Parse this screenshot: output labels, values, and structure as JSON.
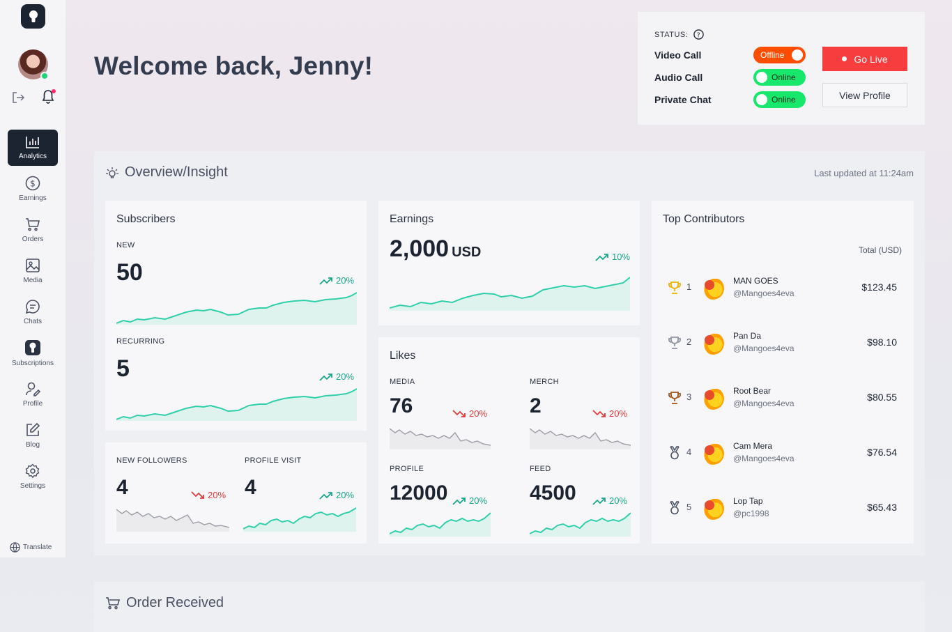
{
  "sidebar": {
    "items": [
      {
        "label": "Analytics",
        "icon": "bar-chart-icon"
      },
      {
        "label": "Earnings",
        "icon": "dollar-icon"
      },
      {
        "label": "Orders",
        "icon": "cart-icon"
      },
      {
        "label": "Media",
        "icon": "image-icon"
      },
      {
        "label": "Chats",
        "icon": "chat-icon"
      },
      {
        "label": "Subscriptions",
        "icon": "keyhole-icon"
      },
      {
        "label": "Profile",
        "icon": "user-icon"
      },
      {
        "label": "Blog",
        "icon": "edit-icon"
      },
      {
        "label": "Settings",
        "icon": "gear-icon"
      }
    ],
    "translate": "Translate"
  },
  "header": {
    "welcome": "Welcome back, Jenny!"
  },
  "status": {
    "label": "STATUS:",
    "rows": [
      {
        "label": "Video Call",
        "state": "Offline"
      },
      {
        "label": "Audio Call",
        "state": "Online"
      },
      {
        "label": "Private Chat",
        "state": "Online"
      }
    ],
    "go_live": "Go Live",
    "view_profile": "View Profile"
  },
  "overview": {
    "title": "Overview/Insight",
    "updated": "Last updated at 11:24am",
    "subscribers": {
      "title": "Subscribers",
      "new_label": "NEW",
      "new_value": "50",
      "new_trend": "20%",
      "recurring_label": "RECURRING",
      "recurring_value": "5",
      "recurring_trend": "20%"
    },
    "followers": {
      "label": "NEW FOLLOWERS",
      "value": "4",
      "trend": "20%"
    },
    "profile_visit": {
      "label": "PROFILE VISIT",
      "value": "4",
      "trend": "20%"
    },
    "earnings": {
      "title": "Earnings",
      "value": "2,000",
      "unit": "USD",
      "trend": "10%"
    },
    "likes": {
      "title": "Likes",
      "media_label": "MEDIA",
      "media_value": "76",
      "media_trend": "20%",
      "merch_label": "MERCH",
      "merch_value": "2",
      "merch_trend": "20%",
      "profile_label": "PROFILE",
      "profile_value": "12000",
      "profile_trend": "20%",
      "feed_label": "FEED",
      "feed_value": "4500",
      "feed_trend": "20%"
    },
    "top_contributors": {
      "title": "Top Contributors",
      "total_label": "Total (USD)",
      "rows": [
        {
          "rank": "1",
          "name": "MAN GOES",
          "handle": "@Mangoes4eva",
          "amount": "$123.45"
        },
        {
          "rank": "2",
          "name": "Pan Da",
          "handle": "@Mangoes4eva",
          "amount": "$98.10"
        },
        {
          "rank": "3",
          "name": "Root Bear",
          "handle": "@Mangoes4eva",
          "amount": "$80.55"
        },
        {
          "rank": "4",
          "name": "Cam Mera",
          "handle": "@Mangoes4eva",
          "amount": "$76.54"
        },
        {
          "rank": "5",
          "name": "Lop Tap",
          "handle": "@pc1998",
          "amount": "$65.43"
        }
      ]
    }
  },
  "orders": {
    "title": "Order Received"
  },
  "colors": {
    "accent_dark": "#1c2331",
    "live_red": "#f73d3d",
    "offline_orange": "#ff4d00",
    "online_green": "#17e86b",
    "trend_up": "#16a88a",
    "trend_down": "#e23a3a"
  }
}
